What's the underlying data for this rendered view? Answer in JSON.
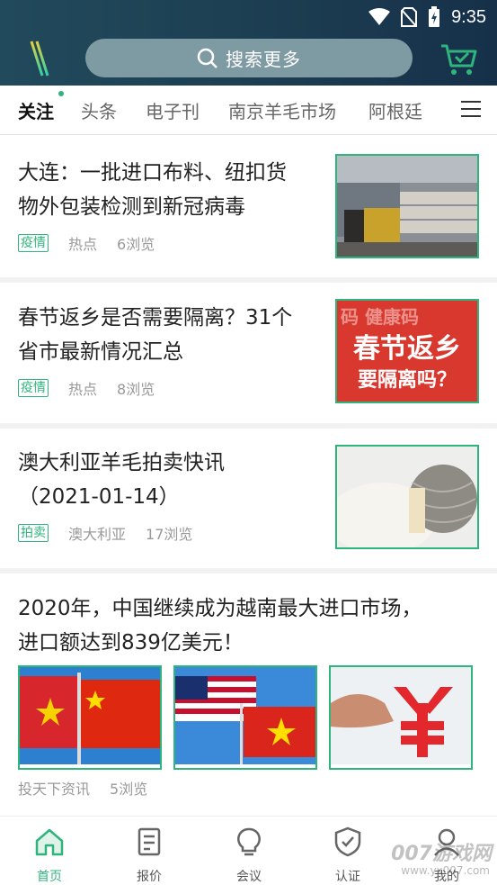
{
  "status": {
    "time": "9:35"
  },
  "header": {
    "search_placeholder": "搜索更多"
  },
  "tabs": [
    {
      "label": "关注",
      "active": true
    },
    {
      "label": "头条"
    },
    {
      "label": "电子刊"
    },
    {
      "label": "南京羊毛市场"
    },
    {
      "label": "阿根廷"
    }
  ],
  "articles": [
    {
      "title_line1": "大连：一批进口布料、纽扣货",
      "title_line2": "物外包装检测到新冠病毒",
      "tag": "疫情",
      "meta1": "热点",
      "meta2": "6浏览"
    },
    {
      "title_line1": "春节返乡是否需要隔离？31个",
      "title_line2": "省市最新情况汇总",
      "tag": "疫情",
      "meta1": "热点",
      "meta2": "8浏览",
      "image_text1": "春节返乡",
      "image_text2": "要隔离吗？",
      "image_text_bg": "码 健康码"
    },
    {
      "title_line1": "澳大利亚羊毛拍卖快讯",
      "title_line2": "（2021-01-14）",
      "tag": "拍卖",
      "meta1": "澳大利亚",
      "meta2": "17浏览"
    },
    {
      "title_line1": "2020年，中国继续成为越南最大进口市场，",
      "title_line2": "进口额达到839亿美元！",
      "meta1": "投天下资讯",
      "meta2": "5浏览"
    }
  ],
  "bottom_nav": [
    {
      "label": "首页",
      "icon": "home-icon",
      "active": true
    },
    {
      "label": "报价",
      "icon": "document-icon"
    },
    {
      "label": "会议",
      "icon": "bulb-icon"
    },
    {
      "label": "认证",
      "icon": "shield-check-icon"
    },
    {
      "label": "我的",
      "icon": "user-icon"
    }
  ],
  "watermark": {
    "line1": "007游戏网",
    "line2": "www.yx007.com"
  },
  "colors": {
    "accent": "#2fb47c",
    "header": "#1d3f52",
    "search_bg": "#7e9aa3"
  }
}
